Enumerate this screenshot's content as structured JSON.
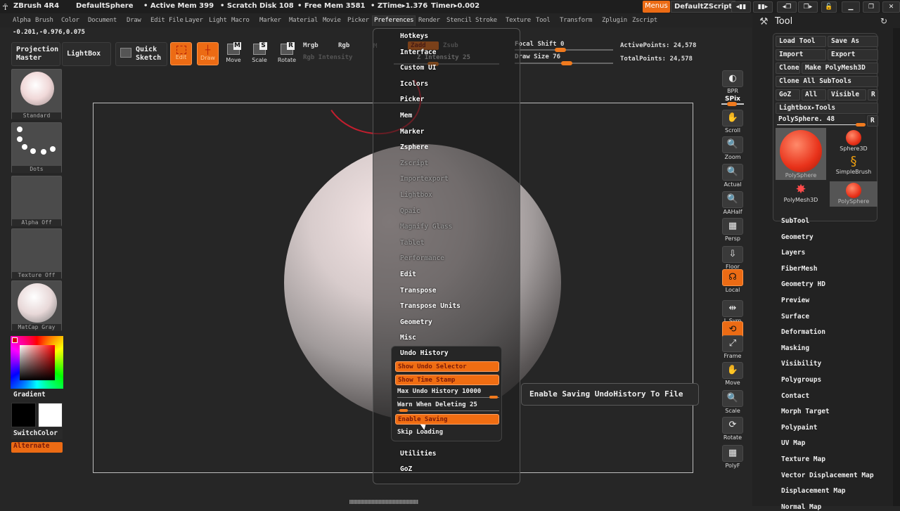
{
  "app": {
    "title": "ZBrush 4R4",
    "document": "DefaultSphere",
    "active_mem": "• Active Mem 399",
    "scratch_disk": "• Scratch Disk 108",
    "free_mem": "• Free Mem 3581",
    "ztime": "• ZTime▸1.376",
    "timer": "Timer▸0.002",
    "menus_button": "Menus",
    "default_zscript": "DefaultZScript"
  },
  "menubar": [
    "Alpha",
    "Brush",
    "Color",
    "Document",
    "Draw",
    "Edit",
    "File",
    "Layer",
    "Light",
    "Macro",
    "Marker",
    "Material",
    "Movie",
    "Picker",
    "Preferences",
    "Render",
    "Stencil",
    "Stroke",
    "Texture",
    "Tool",
    "Transform",
    "Zplugin",
    "Zscript"
  ],
  "menubar_active": "Preferences",
  "coordinates": "-0.201,-0.976,0.075",
  "toolbar": {
    "projection_master": [
      "Projection",
      "Master"
    ],
    "lightbox": "LightBox",
    "quick_sketch": [
      "Quick",
      "Sketch"
    ],
    "edit": "Edit",
    "draw": "Draw",
    "move": "Move",
    "scale": "Scale",
    "rotate": "Rotate",
    "move_key": "M",
    "scale_key": "S",
    "rotate_key": "R",
    "mrgb": "Mrgb",
    "rgb": "Rgb",
    "m": "M",
    "rgb_intensity": "Rgb Intensity",
    "zadd": "Zadd",
    "zsub": "Zsub",
    "z_intensity": "Z Intensity 25",
    "z_intensity_value": 25,
    "focal_shift": "Focal Shift 0",
    "focal_shift_value": 0,
    "draw_size": "Draw Size 76",
    "draw_size_value": 76,
    "active_points": "ActivePoints: 24,578",
    "total_points": "TotalPoints: 24,578"
  },
  "left_shelf": {
    "brush": "Standard",
    "stroke": "Dots",
    "alpha": "Alpha Off",
    "texture": "Texture Off",
    "material": "MatCap Gray",
    "gradient": "Gradient",
    "switch_color": "SwitchColor",
    "alternate": "Alternate"
  },
  "preferences_menu": {
    "items": [
      "Hotkeys",
      "Interface",
      "Custom UI",
      "Icolors",
      "Picker",
      "Mem",
      "Marker",
      "Zsphere",
      "Zscript",
      "Importexport",
      "Lightbox",
      "Qpaic",
      "Magnify Glass",
      "Tablet",
      "Performance",
      "Edit",
      "Transpose",
      "Transpose Units",
      "Geometry",
      "Misc"
    ],
    "undo_history": {
      "title": "Undo History",
      "show_undo_selector": "Show Undo Selector",
      "show_time_stamp": "Show Time Stamp",
      "max_undo_history": "Max Undo History 10000",
      "max_undo_history_value": 10000,
      "warn_when_deleting": "Warn When Deleting 25",
      "warn_when_deleting_value": 25,
      "enable_saving": "Enable Saving",
      "skip_loading": "Skip Loading"
    },
    "after_items": [
      "Utilities",
      "GoZ"
    ]
  },
  "tooltip": "Enable Saving UndoHistory To File",
  "right_shelf": [
    "BPR",
    "SPix",
    "Scroll",
    "Zoom",
    "Actual",
    "AAHalf",
    "Persp",
    "Floor",
    "Local",
    "L.Sym",
    "Gxyz",
    "Frame",
    "Move",
    "Scale",
    "Rotate",
    "PolyF"
  ],
  "tool_panel": {
    "title": "Tool",
    "load_tool": "Load Tool",
    "save_as": "Save As",
    "import": "Import",
    "export": "Export",
    "clone": "Clone",
    "make_polymesh3d": "Make PolyMesh3D",
    "clone_all_subtools": "Clone All SubTools",
    "goz": "GoZ",
    "all": "All",
    "visible": "Visible",
    "r": "R",
    "lightbox_tools": "Lightbox▸Tools",
    "current_tool": "PolySphere. 48",
    "tools": [
      "PolySphere",
      "Sphere3D",
      "SimpleBrush",
      "PolyMesh3D",
      "PolySphere"
    ],
    "sections": [
      "SubTool",
      "Geometry",
      "Layers",
      "FiberMesh",
      "Geometry HD",
      "Preview",
      "Surface",
      "Deformation",
      "Masking",
      "Visibility",
      "Polygroups",
      "Contact",
      "Morph Target",
      "Polypaint",
      "UV Map",
      "Texture Map",
      "Vector Displacement Map",
      "Displacement Map",
      "Normal Map"
    ]
  },
  "colors": {
    "accent_orange": "#ec6b14",
    "background": "#262626",
    "brush_ring": "#c41e2e"
  }
}
